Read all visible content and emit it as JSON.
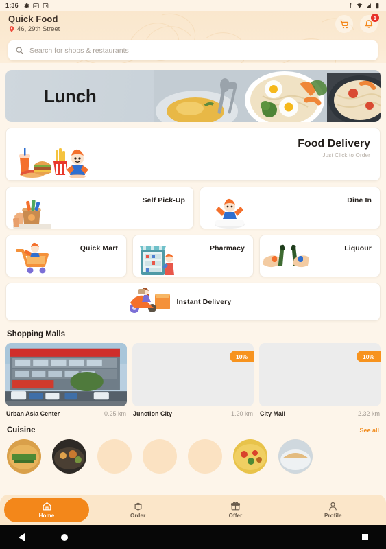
{
  "status_bar": {
    "time": "1:36",
    "left_icons": [
      "gear-icon",
      "screen-record-icon",
      "cast-icon"
    ],
    "right_icons": [
      "usb-icon",
      "wifi-icon",
      "signal-icon",
      "battery-icon"
    ]
  },
  "header": {
    "brand": "Quick Food",
    "address": "46, 29th Street",
    "cart_icon": "cart-icon",
    "bell_icon": "bell-icon",
    "notification_count": "1"
  },
  "search": {
    "placeholder": "Search for shops & restaurants",
    "value": "",
    "icon": "search-icon"
  },
  "banner": {
    "title": "Lunch"
  },
  "food_delivery": {
    "title": "Food Delivery",
    "subtitle": "Just Click to Order"
  },
  "services": {
    "row2": [
      {
        "label": "Self Pick-Up",
        "icon": "paper-bag-icon"
      },
      {
        "label": "Dine In",
        "icon": "dine-in-icon"
      }
    ],
    "row3": [
      {
        "label": "Quick Mart",
        "icon": "shopping-cart-icon"
      },
      {
        "label": "Pharmacy",
        "icon": "pharmacy-icon"
      },
      {
        "label": "Liquour",
        "icon": "bottles-icon"
      }
    ],
    "row4": [
      {
        "label": "Instant Delivery",
        "icon": "scooter-icon"
      }
    ]
  },
  "shopping_malls": {
    "title": "Shopping Malls",
    "items": [
      {
        "name": "Urban Asia Center",
        "distance": "0.25 km",
        "discount": ""
      },
      {
        "name": "Junction City",
        "distance": "1.20 km",
        "discount": "10%"
      },
      {
        "name": "City Mall",
        "distance": "2.32 km",
        "discount": "10%"
      }
    ]
  },
  "cuisine": {
    "title": "Cuisine",
    "see_all": "See all",
    "items": [
      {
        "name": "cuisine-1"
      },
      {
        "name": "cuisine-2"
      },
      {
        "name": "cuisine-3"
      },
      {
        "name": "cuisine-4"
      },
      {
        "name": "cuisine-5"
      },
      {
        "name": "cuisine-6"
      },
      {
        "name": "cuisine-7"
      }
    ]
  },
  "bottom_nav": {
    "items": [
      {
        "label": "Home",
        "icon": "home-icon",
        "active": true
      },
      {
        "label": "Order",
        "icon": "order-icon",
        "active": false
      },
      {
        "label": "Offer",
        "icon": "gift-icon",
        "active": false
      },
      {
        "label": "Profile",
        "icon": "person-icon",
        "active": false
      }
    ]
  },
  "android_nav": {
    "back": "back-icon",
    "home": "home-circle-icon",
    "recents": "recents-square-icon"
  },
  "colors": {
    "accent": "#f3871a",
    "badge_red": "#e8322a",
    "header_bg": "#fae7cd",
    "page_bg": "#fdf5ea",
    "banner_bg": "#c9d2d9"
  }
}
